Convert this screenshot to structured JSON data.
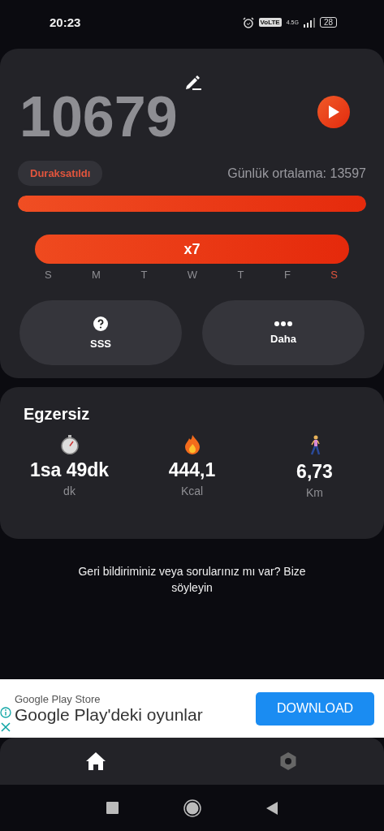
{
  "status_bar": {
    "time": "20:23",
    "network_badge": "VoLTE",
    "network_type": "4.5G",
    "battery": "28"
  },
  "steps_card": {
    "steps": "10679",
    "status": "Duraksatıldı",
    "daily_average": "Günlük ortalama: 13597",
    "progress": {
      "level": 1
    },
    "streak": "x7",
    "weekdays": [
      {
        "label": "S",
        "today": false
      },
      {
        "label": "M",
        "today": false
      },
      {
        "label": "T",
        "today": false
      },
      {
        "label": "W",
        "today": false
      },
      {
        "label": "T",
        "today": false
      },
      {
        "label": "F",
        "today": false
      },
      {
        "label": "S",
        "today": true
      }
    ],
    "buttons": [
      {
        "kind": "faq",
        "label": "SSS"
      },
      {
        "kind": "more",
        "label": "Daha"
      }
    ]
  },
  "exercise_card": {
    "title": "Egzersiz",
    "stats": [
      {
        "kind": "time",
        "value": "1sa 49dk",
        "unit": "dk"
      },
      {
        "kind": "calories",
        "value": "444,1",
        "unit": "Kcal"
      },
      {
        "kind": "distance",
        "value": "6,73",
        "unit": "Km"
      }
    ]
  },
  "feedback": "Geri bildiriminiz veya sorularınız mı var? Bize söyleyin",
  "ad": {
    "source": "Google Play Store",
    "headline": "Google Play'deki oyunlar",
    "button": "DOWNLOAD"
  },
  "bottom_nav": [
    {
      "kind": "home",
      "selected": true
    },
    {
      "kind": "settings",
      "selected": false
    }
  ]
}
